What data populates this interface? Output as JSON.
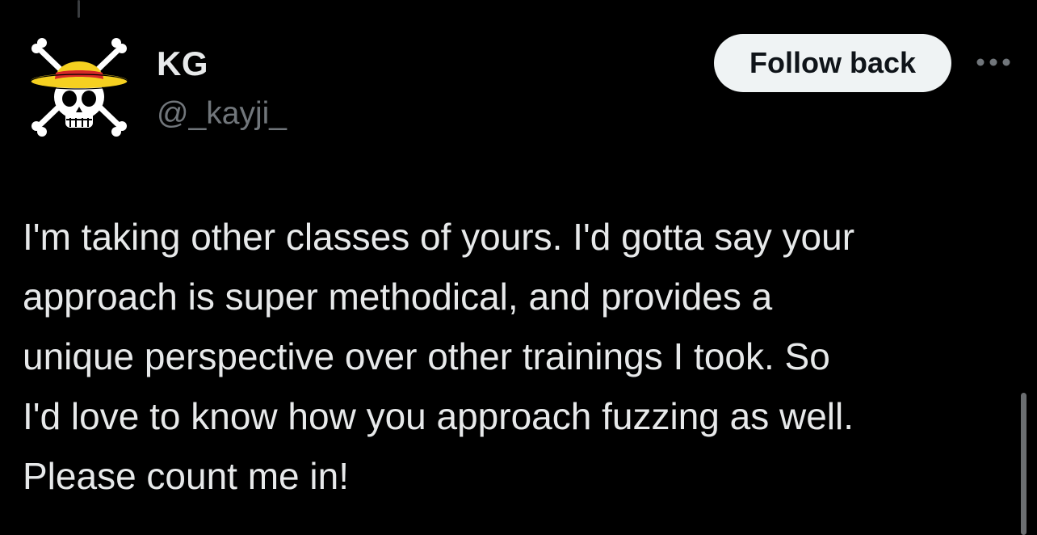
{
  "tweet": {
    "author": {
      "display_name": "KG",
      "handle": "@_kayji_",
      "avatar_icon": "straw-hat-jolly-roger-icon"
    },
    "follow_button_label": "Follow back",
    "more_icon": "more-horizontal-icon",
    "text_lines": [
      "I'm taking other classes of yours. I'd gotta say your",
      "approach is super methodical, and provides a",
      "unique perspective over other trainings I took. So",
      "I'd love to know how you approach fuzzing as well.",
      "Please count me in!"
    ]
  },
  "colors": {
    "background": "#000000",
    "primary_text": "#e7e9ea",
    "secondary_text": "#71767b",
    "button_bg": "#eff3f4",
    "button_text": "#0f1419",
    "hat_yellow": "#f5d020",
    "hat_band": "#d62828"
  }
}
